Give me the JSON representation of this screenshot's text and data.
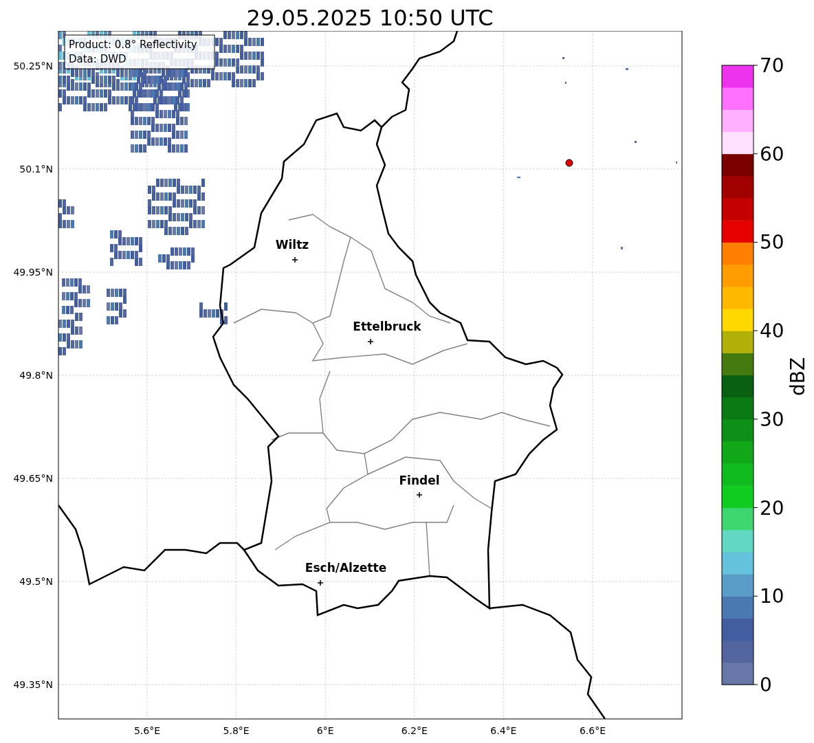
{
  "title": "29.05.2025 10:50 UTC",
  "info_box": [
    "Product: 0.8° Reflectivity",
    "Data: DWD"
  ],
  "y_ticks": [
    "50.25°N",
    "50.1°N",
    "49.95°N",
    "49.8°N",
    "49.65°N",
    "49.5°N",
    "49.35°N"
  ],
  "x_ticks": [
    "5.6°E",
    "5.8°E",
    "6°E",
    "6.2°E",
    "6.4°E",
    "6.6°E"
  ],
  "cities": [
    {
      "name": "Wiltz"
    },
    {
      "name": "Ettelbruck"
    },
    {
      "name": "Findel"
    },
    {
      "name": "Esch/Alzette"
    }
  ],
  "colorbar": {
    "label": "dBZ",
    "ticks": [
      "70",
      "60",
      "50",
      "40",
      "30",
      "20",
      "10",
      "0"
    ],
    "bands": [
      {
        "color": "#6677a8"
      },
      {
        "color": "#52659f"
      },
      {
        "color": "#435ea0"
      },
      {
        "color": "#4a78b0"
      },
      {
        "color": "#5a9cc8"
      },
      {
        "color": "#64c2dc"
      },
      {
        "color": "#62d8c4"
      },
      {
        "color": "#3ed66e"
      },
      {
        "color": "#10cc20"
      },
      {
        "color": "#10bb20"
      },
      {
        "color": "#10a818"
      },
      {
        "color": "#0e9018"
      },
      {
        "color": "#0c7a14"
      },
      {
        "color": "#086010"
      },
      {
        "color": "#447a10"
      },
      {
        "color": "#b0b008"
      },
      {
        "color": "#ffd800"
      },
      {
        "color": "#ffb800"
      },
      {
        "color": "#ff9c00"
      },
      {
        "color": "#ff8000"
      },
      {
        "color": "#e60000"
      },
      {
        "color": "#c40000"
      },
      {
        "color": "#a00000"
      },
      {
        "color": "#7a0000"
      },
      {
        "color": "#ffe0ff"
      },
      {
        "color": "#ffb0ff"
      },
      {
        "color": "#ff70ff"
      },
      {
        "color": "#ee33ee"
      }
    ]
  }
}
